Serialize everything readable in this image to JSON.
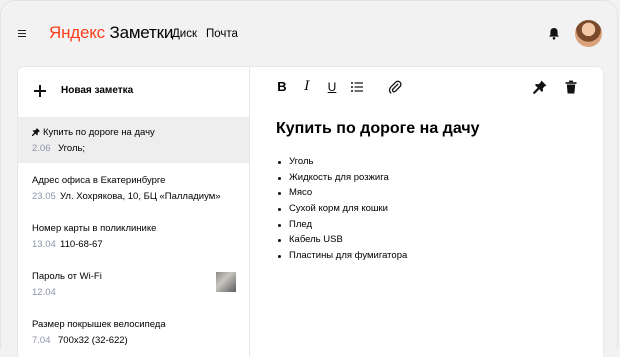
{
  "header": {
    "logo_brand": "Яндекс",
    "logo_app": "Заметки",
    "nav": [
      "Диск",
      "Почта"
    ]
  },
  "sidebar": {
    "new_note_label": "Новая заметка",
    "notes": [
      {
        "title": "Купить по дороге на дачу",
        "pinned": true,
        "date": "2.06",
        "preview": "Уголь;"
      },
      {
        "title": "Адрес офиса в Екатеринбурге",
        "date": "23.05",
        "preview": "Ул. Хохрякова, 10, БЦ «Палладиум»"
      },
      {
        "title": "Номер карты в поликлинике",
        "date": "13.04",
        "preview": "110-68-67"
      },
      {
        "title": "Пароль от Wi-Fi",
        "date": "12.04",
        "preview": "",
        "has_thumbnail": true
      },
      {
        "title": "Размер покрышек велосипеда",
        "date": "7.04",
        "preview": "700x32 (32-622)"
      }
    ]
  },
  "editor": {
    "toolbar": {
      "bold": "B",
      "italic": "I",
      "underline": "U"
    },
    "title": "Купить по дороге на дачу",
    "items": [
      "Уголь",
      "Жидкость для розжига",
      "Мясо",
      "Сухой корм для кошки",
      "Плед",
      "Кабель USB",
      "Пластины для фумигатора"
    ]
  },
  "colors": {
    "brand_red": "#fc3f1d",
    "date_gray": "#8e93a8",
    "active_row": "#eeeeee"
  }
}
